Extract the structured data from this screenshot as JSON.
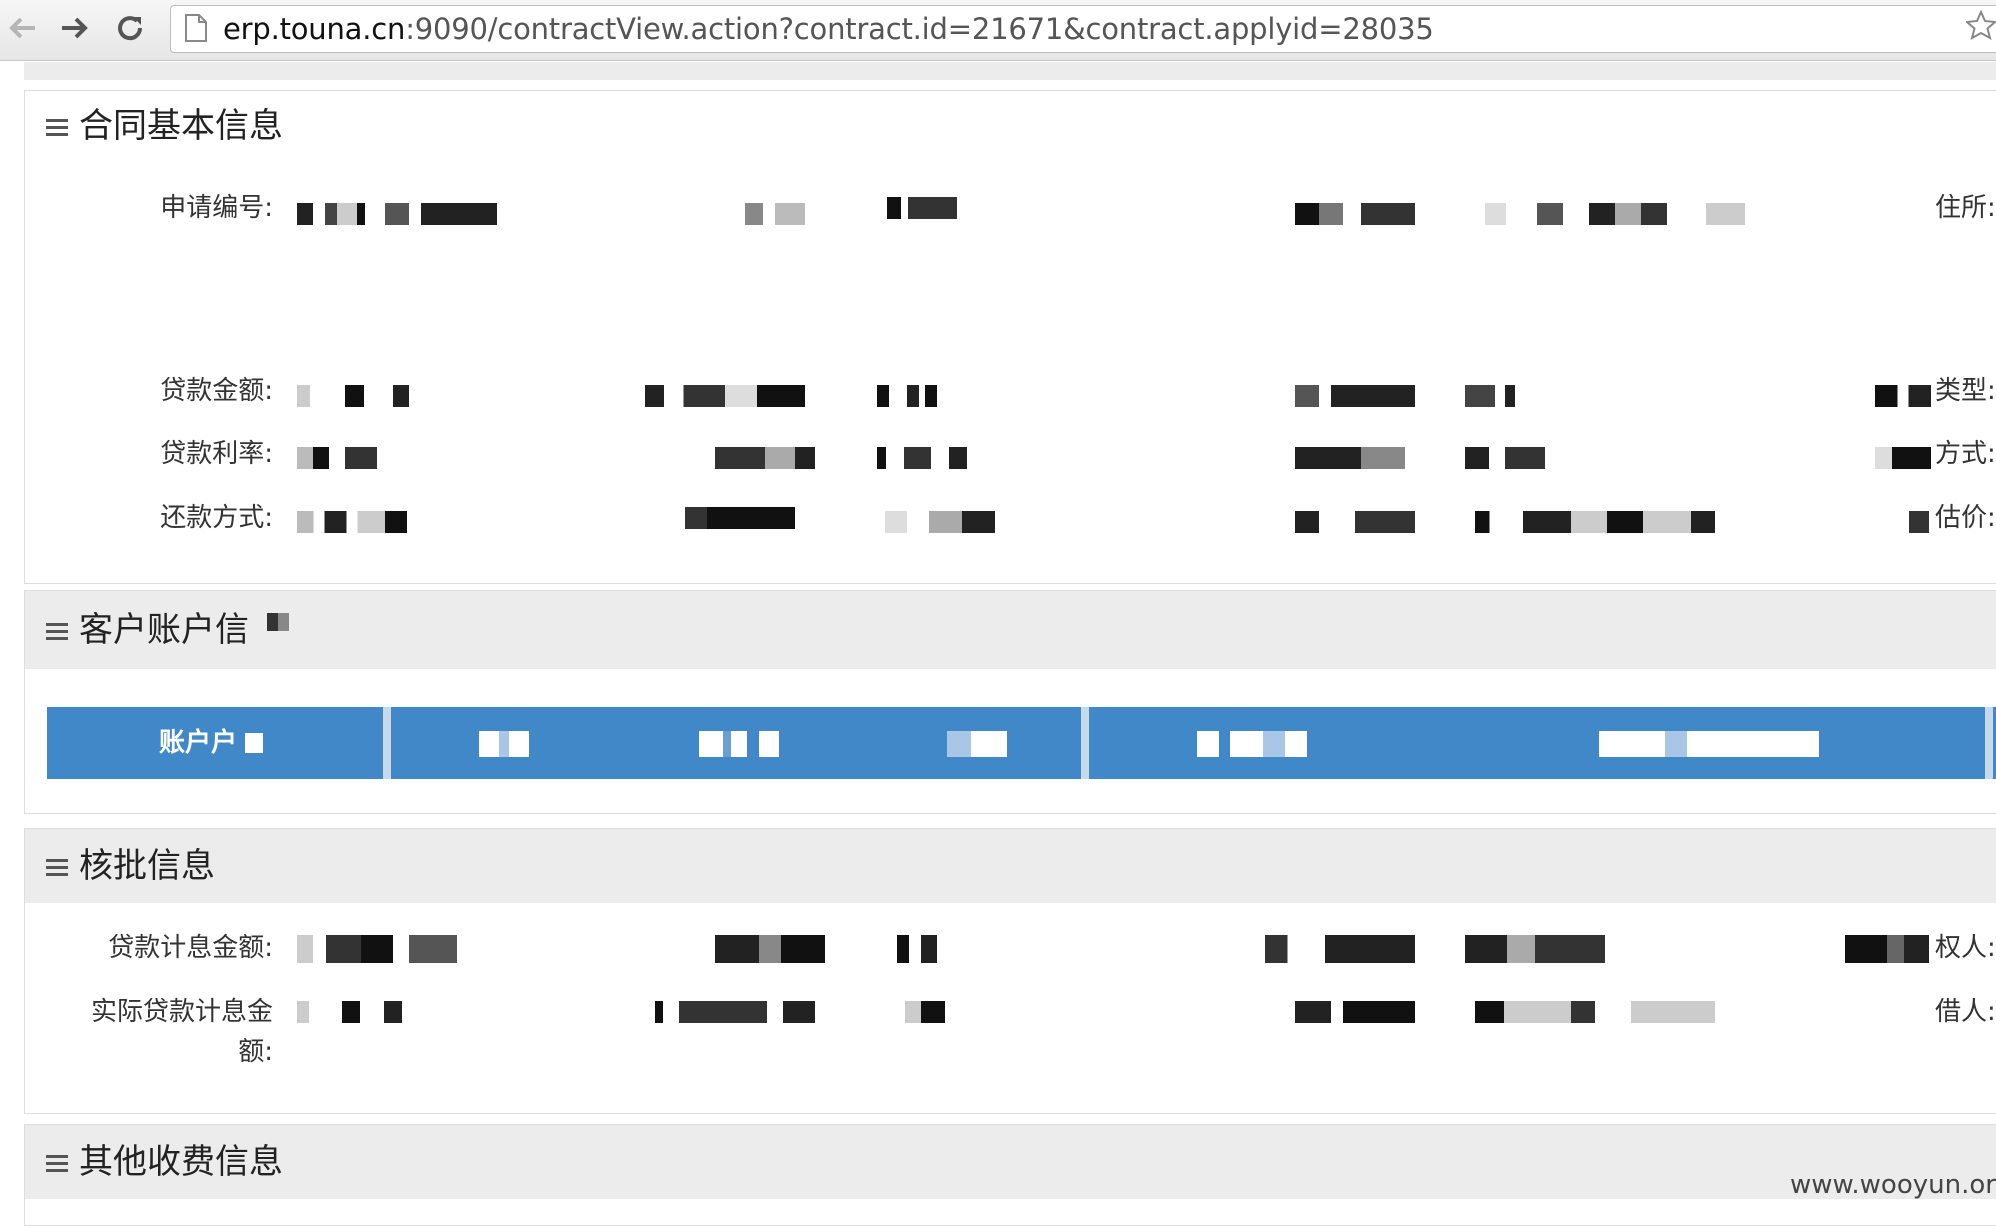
{
  "browser": {
    "url_host": "erp.touna.cn",
    "url_rest": ":9090/contractView.action?contract.id=21671&contract.applyid=28035",
    "icons": [
      "back-icon",
      "forward-icon",
      "reload-icon",
      "page-icon",
      "star-icon"
    ]
  },
  "sections": {
    "basic": {
      "title": "合同基本信息",
      "fields": {
        "apply_no": "申请编号:",
        "address": "住所:",
        "loan_amount": "贷款金额:",
        "type": "类型:",
        "loan_rate": "贷款利率:",
        "method": "方式:",
        "repay_method": "还款方式:",
        "valuation": "估价:"
      }
    },
    "account": {
      "title": "客户账户信",
      "header_first": "账户户"
    },
    "approval": {
      "title": "核批信息",
      "fields": {
        "interest_amount": "贷款计息金额:",
        "actual_interest_amount_1": "实际贷款计息金",
        "actual_interest_amount_2": "额:",
        "right_holder": "权人:",
        "borrower": "借人:"
      }
    },
    "other": {
      "title": "其他收费信息"
    }
  },
  "watermark": "www.wooyun.org"
}
